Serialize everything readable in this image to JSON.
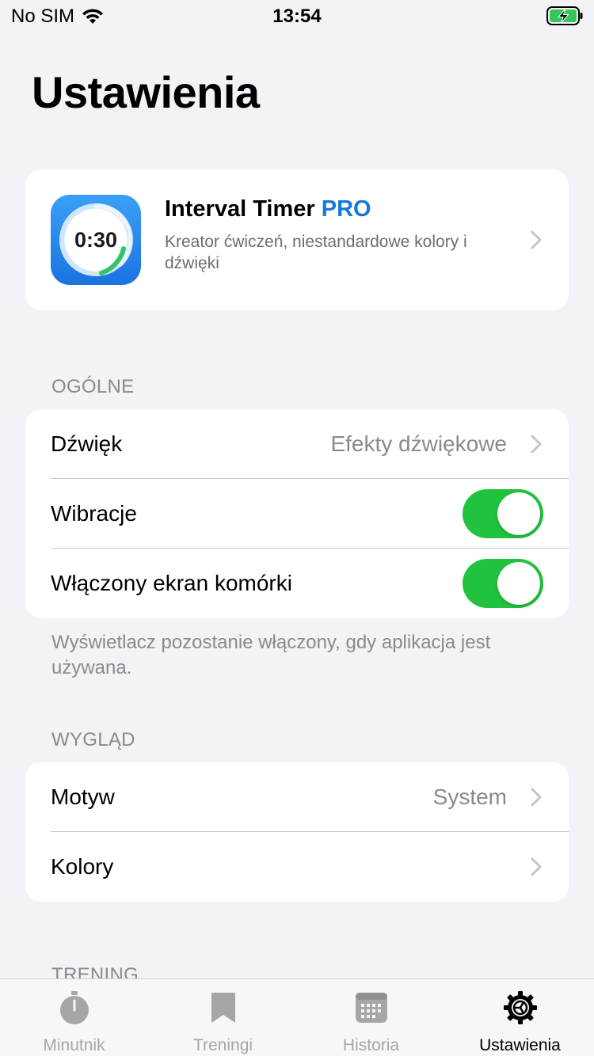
{
  "status_bar": {
    "carrier": "No SIM",
    "time": "13:54"
  },
  "page_title": "Ustawienia",
  "pro_card": {
    "icon_time": "0:30",
    "title_main": "Interval Timer",
    "title_pro": "PRO",
    "subtitle": "Kreator ćwiczeń, niestandardowe kolory i dźwięki"
  },
  "general": {
    "header": "OGÓLNE",
    "sound_label": "Dźwięk",
    "sound_value": "Efekty dźwiękowe",
    "vibration_label": "Wibracje",
    "vibration_on": true,
    "screen_label": "Włączony ekran komórki",
    "screen_on": true,
    "note": "Wyświetlacz pozostanie włączony, gdy aplikacja jest używana."
  },
  "appearance": {
    "header": "WYGLĄD",
    "theme_label": "Motyw",
    "theme_value": "System",
    "colors_label": "Kolory"
  },
  "training_header": "TRENING",
  "tabs": [
    {
      "label": "Minutnik",
      "icon": "stopwatch-icon"
    },
    {
      "label": "Treningi",
      "icon": "bookmark-icon"
    },
    {
      "label": "Historia",
      "icon": "calendar-icon"
    },
    {
      "label": "Ustawienia",
      "icon": "gear-icon",
      "active": true
    }
  ],
  "colors": {
    "accent_pro": "#1479d8",
    "toggle_on": "#20c23e",
    "background": "#f2f2f7"
  }
}
